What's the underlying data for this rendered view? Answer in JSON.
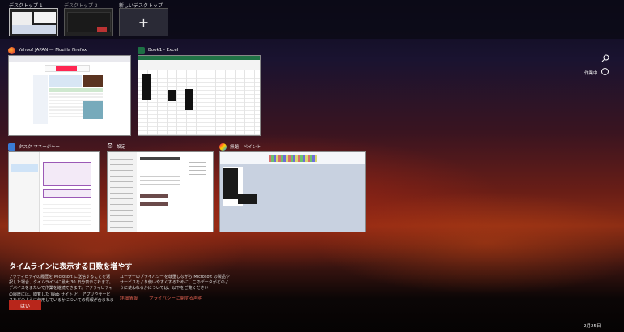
{
  "desktops": [
    {
      "label": "デスクトップ 1",
      "active": true
    },
    {
      "label": "デスクトップ 2",
      "active": false
    },
    {
      "label": "新しいデスクトップ",
      "symbol": "+"
    }
  ],
  "windows": [
    {
      "title": "Yahoo! JAPAN — Mozilla Firefox",
      "icon": "firefox-icon",
      "color": "#e8542b"
    },
    {
      "title": "Book1 - Excel",
      "icon": "excel-icon",
      "color": "#1d7044"
    },
    {
      "title": "タスク マネージャー",
      "icon": "task-manager-icon",
      "color": "#3a7bd5"
    },
    {
      "title": "設定",
      "icon": "gear-icon",
      "color": "#ffffff"
    },
    {
      "title": "無題 - ペイント",
      "icon": "paint-icon",
      "color": "#d0d0e8"
    }
  ],
  "timeline": {
    "now_label": "作業中",
    "date_label": "2月25日"
  },
  "promo": {
    "title": "タイムラインに表示する日数を増やす",
    "text_left": "アクティビティの履歴を Microsoft に送信することを選択した場合、タイムラインに最大 30 日分表示されます。デバイスをまたいで作業を継続できます。アクティビティの履歴には、閲覧した Web サイト と、アプリやサービスをどのように使用しているかについての情報が含まれます。",
    "text_right": "ユーザーのプライバシーを尊重しながら Microsoft の製品やサービスをより使いやすくするために、このデータがどのように使われるかについては、以下をご覧ください",
    "link1": "詳細情報",
    "link2": "プライバシーに関する声明",
    "yes_button": "はい"
  }
}
